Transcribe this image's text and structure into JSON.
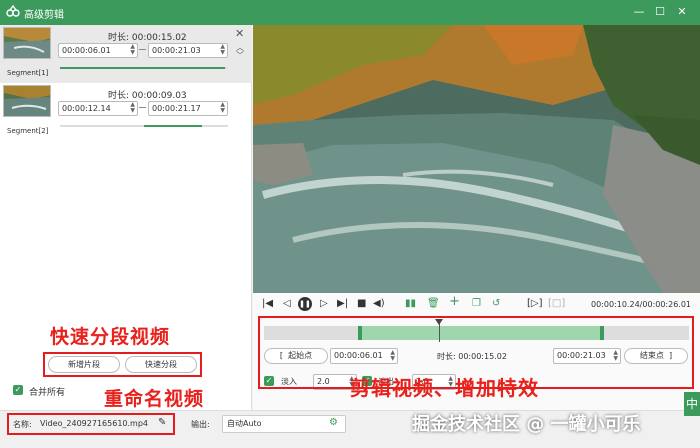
{
  "window": {
    "title": "高级剪辑"
  },
  "segments": [
    {
      "label": "Segment[1]",
      "duration_label": "时长:",
      "duration": "00:00:15.02",
      "start": "00:00:06.01",
      "end": "00:00:21.03",
      "progress": 0.98
    },
    {
      "label": "Segment[2]",
      "duration_label": "时长:",
      "duration": "00:00:09.03",
      "start": "00:00:12.14",
      "end": "00:00:21.17",
      "progress": 0.35
    }
  ],
  "left_actions": {
    "add_segment": "新增片段",
    "quick_segment": "快速分段",
    "merge_all": "合并所有"
  },
  "annotations": {
    "quick_segment_video": "快速分段视频",
    "rename_video": "重命名视频",
    "edit_video": "剪辑视频、增加特效"
  },
  "player": {
    "time_display": "00:00:10.24/00:00:26.01"
  },
  "edit": {
    "start_point": "起始点",
    "start_value": "00:00:06.01",
    "duration_label": "时长:",
    "duration_value": "00:00:15.02",
    "end_value": "00:00:21.03",
    "end_point": "结束点",
    "fade_in": "淡入",
    "fade_in_value": "2.0",
    "fade_out": "淡出",
    "fade_out_value": "2.0"
  },
  "bottom": {
    "name_label": "名称:",
    "name_value": "Video_240927165610.mp4",
    "output_label": "输出:",
    "output_value": "自动Auto"
  },
  "watermark": {
    "text": "掘金技术社区 @ 一罐小可乐",
    "partial": "中"
  },
  "colors": {
    "accent": "#3b9a5c",
    "annotation": "#e8211c"
  }
}
